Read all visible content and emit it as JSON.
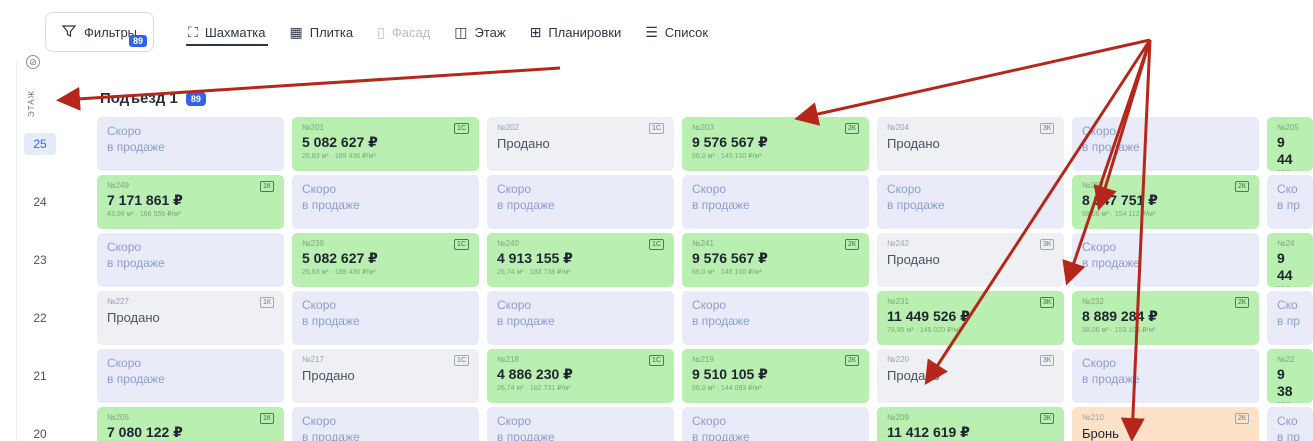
{
  "toolbar": {
    "filters_label": "Фильтры",
    "filters_count": "89",
    "tabs": [
      {
        "label": "Шахматка",
        "icon": "chess-icon",
        "state": "active"
      },
      {
        "label": "Плитка",
        "icon": "tiles-icon",
        "state": "normal"
      },
      {
        "label": "Фасад",
        "icon": "facade-icon",
        "state": "disabled"
      },
      {
        "label": "Этаж",
        "icon": "floor-icon",
        "state": "normal"
      },
      {
        "label": "Планировки",
        "icon": "layouts-icon",
        "state": "normal"
      },
      {
        "label": "Список",
        "icon": "list-icon",
        "state": "normal"
      }
    ]
  },
  "floor_axis_label": "ЭТАЖ",
  "entrance": {
    "title": "Подъезд 1",
    "count": "89"
  },
  "floors": [
    "25",
    "24",
    "23",
    "22",
    "21",
    "20"
  ],
  "current_floor": "25",
  "colors": {
    "sale": "#b9efb0",
    "soon": "#e9ecf8",
    "sold": "#eef0f4",
    "reserved": "#fde1c9",
    "accent": "#2f64e8",
    "arrow": "#b5271a"
  },
  "rows": [
    [
      {
        "kind": "soon",
        "line1": "Скоро",
        "line2": "в продаже"
      },
      {
        "kind": "sale",
        "num": "№201",
        "type": "1С",
        "price": "5 082 627 ₽",
        "meta": "26,83 м² · 189 436 ₽/м²"
      },
      {
        "kind": "sold",
        "num": "№202",
        "type": "1С",
        "status": "Продано"
      },
      {
        "kind": "sale",
        "num": "№203",
        "type": "2К",
        "price": "9 576 567 ₽",
        "meta": "66,0 м² · 145 100 ₽/м²"
      },
      {
        "kind": "sold",
        "num": "№204",
        "type": "3К",
        "status": "Продано"
      },
      {
        "kind": "soon",
        "line1": "Скоро",
        "line2": "в продаже"
      },
      {
        "kind": "sale",
        "num": "№205",
        "price": "9 44",
        "meta": "57,8 м",
        "partial": true
      }
    ],
    [
      {
        "kind": "sale",
        "num": "№249",
        "type": "1К",
        "price": "7 171 861 ₽",
        "meta": "43,06 м² · 166 555 ₽/м²"
      },
      {
        "kind": "soon",
        "line1": "Скоро",
        "line2": "в продаже"
      },
      {
        "kind": "soon",
        "line1": "Скоро",
        "line2": "в продаже"
      },
      {
        "kind": "soon",
        "line1": "Скоро",
        "line2": "в продаже"
      },
      {
        "kind": "soon",
        "line1": "Скоро",
        "line2": "в продаже"
      },
      {
        "kind": "sale",
        "num": "№254",
        "type": "2К",
        "price": "8 947 751 ₽",
        "meta": "58,06 м² · 154 112 ₽/м²"
      },
      {
        "kind": "soon",
        "line1": "Ско",
        "line2": "в пр",
        "partial": true
      }
    ],
    [
      {
        "kind": "soon",
        "line1": "Скоро",
        "line2": "в продаже"
      },
      {
        "kind": "sale",
        "num": "№239",
        "type": "1С",
        "price": "5 082 627 ₽",
        "meta": "26,83 м² · 189 436 ₽/м²"
      },
      {
        "kind": "sale",
        "num": "№240",
        "type": "1С",
        "price": "4 913 155 ₽",
        "meta": "26,74 м² · 183 738 ₽/м²"
      },
      {
        "kind": "sale",
        "num": "№241",
        "type": "2К",
        "price": "9 576 567 ₽",
        "meta": "66,0 м² · 145 100 ₽/м²"
      },
      {
        "kind": "sold",
        "num": "№242",
        "type": "3К",
        "status": "Продано"
      },
      {
        "kind": "soon",
        "line1": "Скоро",
        "line2": "в продаже"
      },
      {
        "kind": "sale",
        "num": "№24",
        "price": "9 44",
        "meta": "57,8 м",
        "partial": true
      }
    ],
    [
      {
        "kind": "sold",
        "num": "№227",
        "type": "1К",
        "status": "Продано"
      },
      {
        "kind": "soon",
        "line1": "Скоро",
        "line2": "в продаже"
      },
      {
        "kind": "soon",
        "line1": "Скоро",
        "line2": "в продаже"
      },
      {
        "kind": "soon",
        "line1": "Скоро",
        "line2": "в продаже"
      },
      {
        "kind": "sale",
        "num": "№231",
        "type": "3К",
        "price": "11 449 526 ₽",
        "meta": "78,95 м² · 145 020 ₽/м²"
      },
      {
        "kind": "sale",
        "num": "№232",
        "type": "2К",
        "price": "8 889 284 ₽",
        "meta": "58,06 м² · 153 105 ₽/м²"
      },
      {
        "kind": "soon",
        "line1": "Ско",
        "line2": "в пр",
        "partial": true
      }
    ],
    [
      {
        "kind": "soon",
        "line1": "Скоро",
        "line2": "в продаже"
      },
      {
        "kind": "sold",
        "num": "№217",
        "type": "1С",
        "status": "Продано"
      },
      {
        "kind": "sale",
        "num": "№218",
        "type": "1С",
        "price": "4 886 230 ₽",
        "meta": "26,74 м² · 182 731 ₽/м²"
      },
      {
        "kind": "sale",
        "num": "№219",
        "type": "2К",
        "price": "9 510 105 ₽",
        "meta": "66,0 м² · 144 093 ₽/м²"
      },
      {
        "kind": "sold",
        "num": "№220",
        "type": "3К",
        "status": "Продано"
      },
      {
        "kind": "soon",
        "line1": "Скоро",
        "line2": "в продаже"
      },
      {
        "kind": "sale",
        "num": "№22",
        "price": "9 38",
        "meta": "57,8 м",
        "partial": true
      }
    ],
    [
      {
        "kind": "sale",
        "num": "№205",
        "type": "1К",
        "price": "7 080 122 ₽",
        "meta": ""
      },
      {
        "kind": "soon",
        "line1": "Скоро",
        "line2": "в продаже"
      },
      {
        "kind": "soon",
        "line1": "Скоро",
        "line2": "в продаже"
      },
      {
        "kind": "soon",
        "line1": "Скоро",
        "line2": "в продаже"
      },
      {
        "kind": "sale",
        "num": "№209",
        "type": "3К",
        "price": "11 412 619 ₽",
        "meta": ""
      },
      {
        "kind": "reserved",
        "num": "№210",
        "type": "2К",
        "status": "Бронь"
      },
      {
        "kind": "soon",
        "line1": "Ско",
        "line2": "в пр",
        "partial": true
      }
    ]
  ]
}
